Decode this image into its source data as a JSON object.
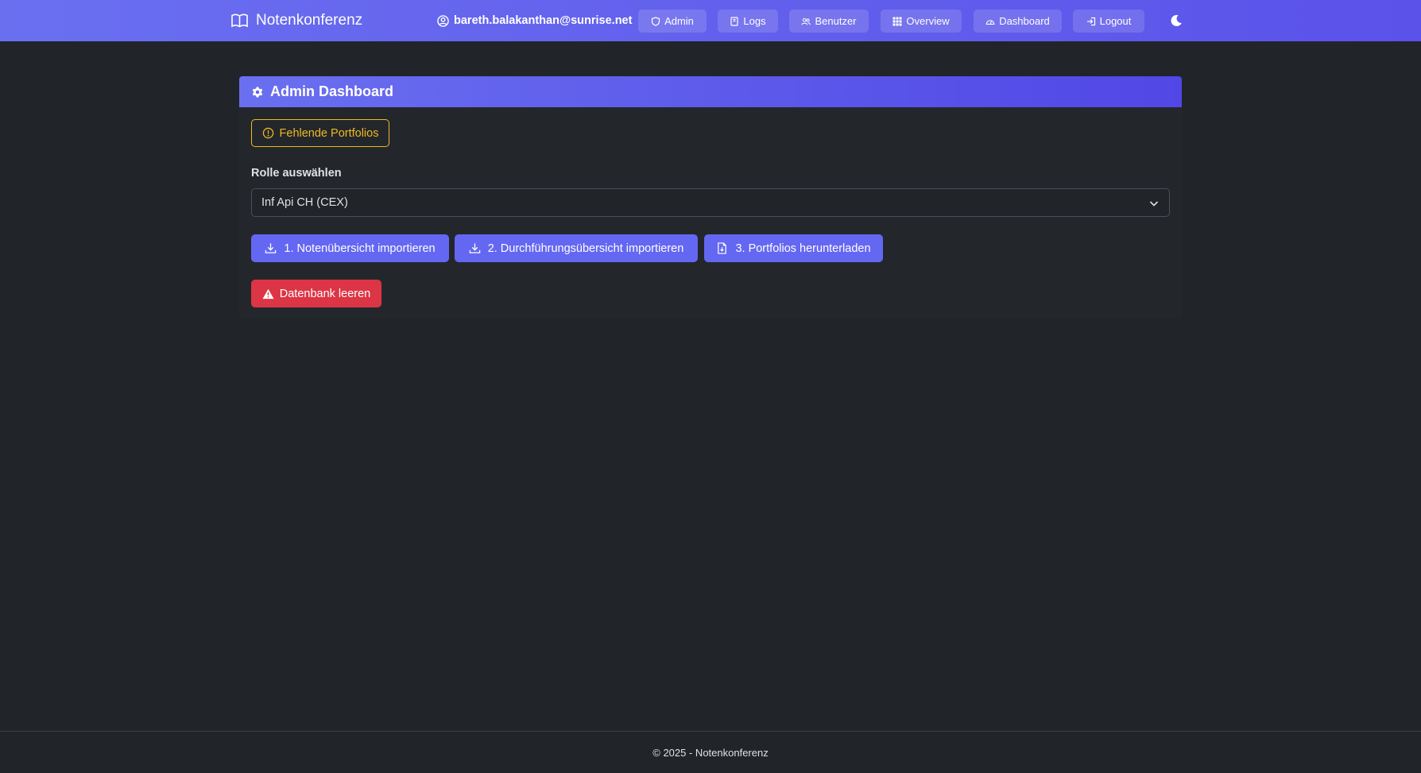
{
  "navbar": {
    "brand": "Notenkonferenz",
    "user_email": "bareth.balakanthan@sunrise.net",
    "items": [
      {
        "label": "Admin",
        "icon": "shield-icon"
      },
      {
        "label": "Logs",
        "icon": "journal-icon"
      },
      {
        "label": "Benutzer",
        "icon": "users-icon"
      },
      {
        "label": "Overview",
        "icon": "grid-icon"
      },
      {
        "label": "Dashboard",
        "icon": "speedometer-icon"
      },
      {
        "label": "Logout",
        "icon": "logout-icon"
      }
    ],
    "theme_toggle_icon": "moon-icon"
  },
  "card": {
    "title": "Admin Dashboard",
    "missing_portfolios_label": "Fehlende Portfolios",
    "role_label": "Rolle auswählen",
    "role_selected": "Inf Api CH (CEX)",
    "actions": [
      "1. Notenübersicht importieren",
      "2. Durchführungsübersicht importieren",
      "3. Portfolios herunterladen"
    ],
    "danger_label": "Datenbank leeren"
  },
  "footer": {
    "text": "© 2025 - Notenkonferenz"
  },
  "colors": {
    "accent": "#6467f2",
    "warning": "#f0b91e",
    "danger": "#dc3545",
    "background": "#212529"
  }
}
